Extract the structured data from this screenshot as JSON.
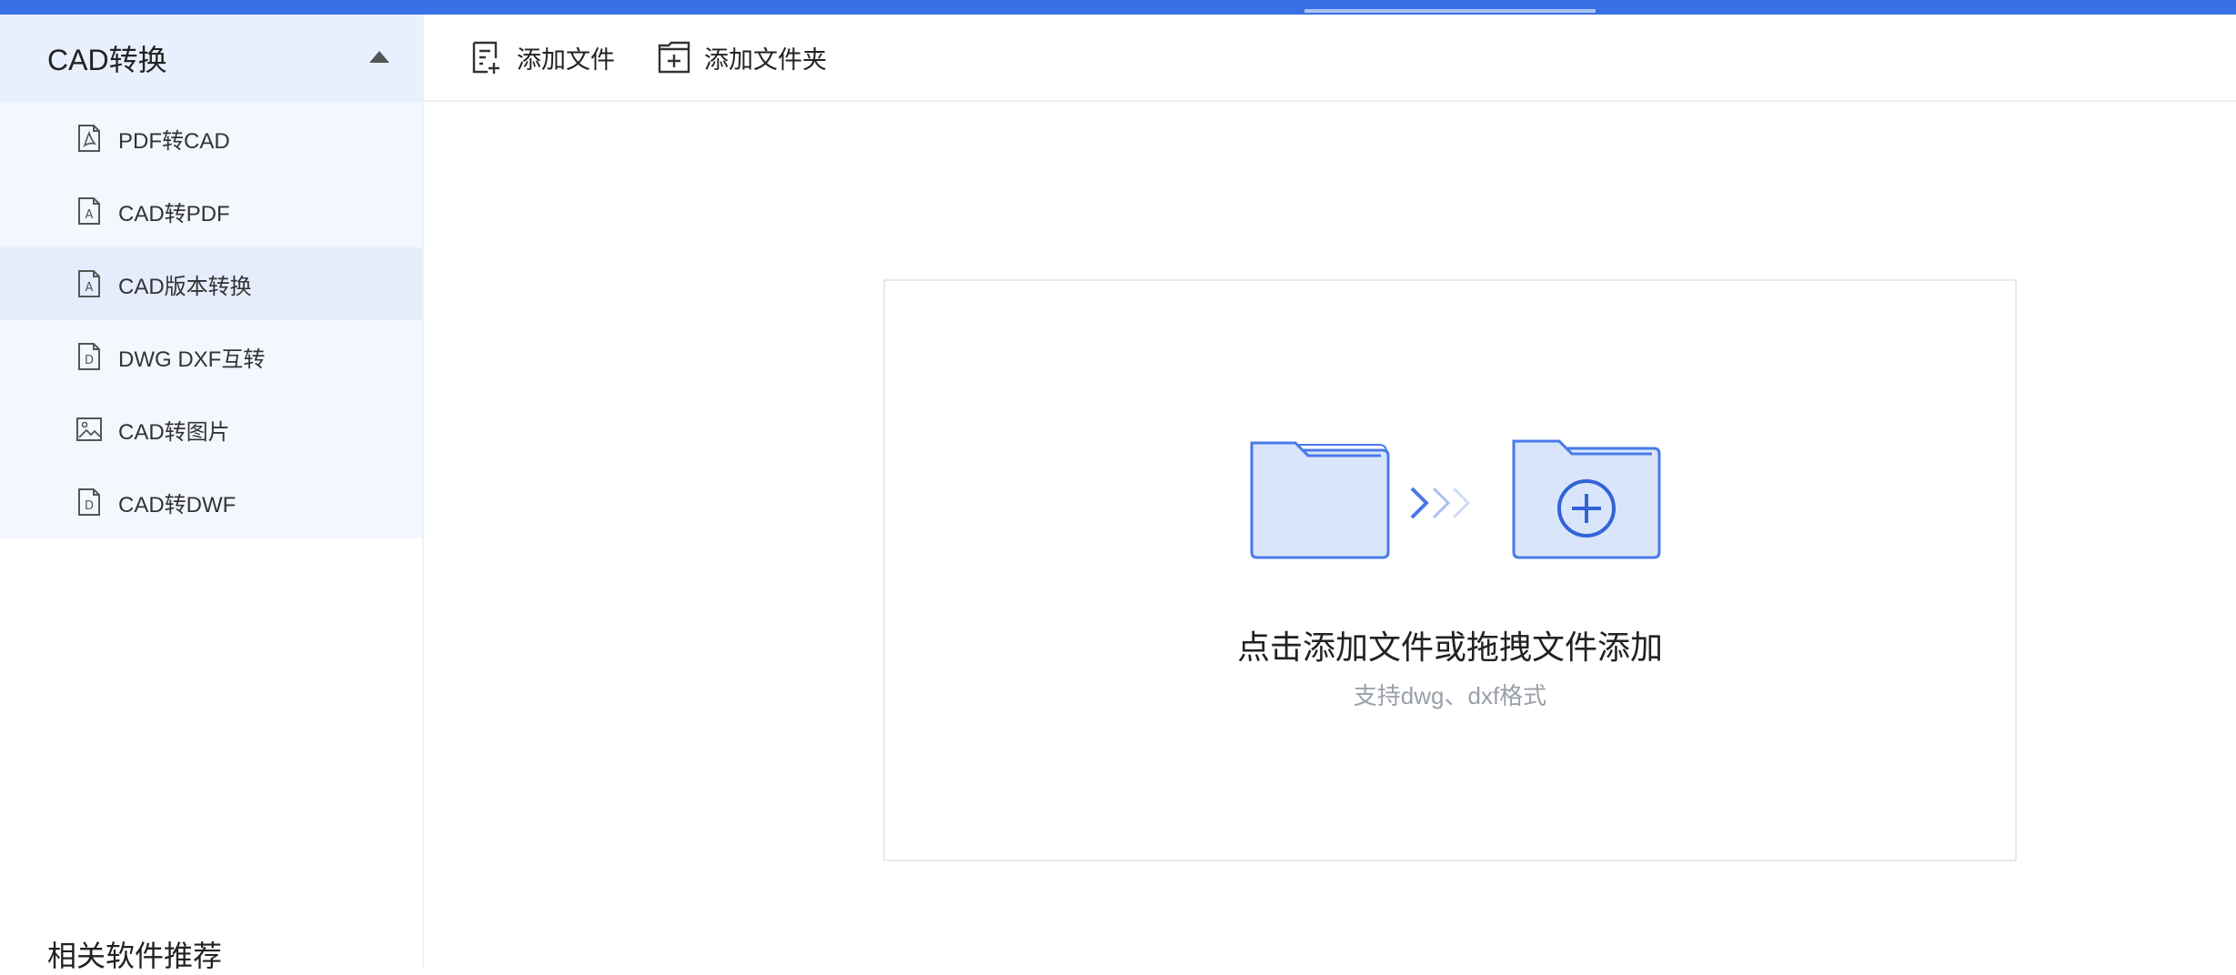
{
  "sidebar": {
    "group_title": "CAD转换",
    "items": [
      {
        "label": "PDF转CAD",
        "icon": "pdf-file-icon"
      },
      {
        "label": "CAD转PDF",
        "icon": "a-file-icon"
      },
      {
        "label": "CAD版本转换",
        "icon": "a-file-icon",
        "active": true
      },
      {
        "label": "DWG DXF互转",
        "icon": "d-file-icon"
      },
      {
        "label": "CAD转图片",
        "icon": "image-icon"
      },
      {
        "label": "CAD转DWF",
        "icon": "d-file-icon"
      }
    ],
    "related_title": "相关软件推荐"
  },
  "toolbar": {
    "add_file_label": "添加文件",
    "add_folder_label": "添加文件夹"
  },
  "drop_zone": {
    "title": "点击添加文件或拖拽文件添加",
    "subtitle": "支持dwg、dxf格式"
  },
  "colors": {
    "accent": "#3a70e6",
    "sidebar_bg": "#f3f7fe",
    "sidebar_active": "#e5edfc",
    "illustration_stroke": "#4a7ae8",
    "illustration_fill": "#d9e5fb"
  }
}
